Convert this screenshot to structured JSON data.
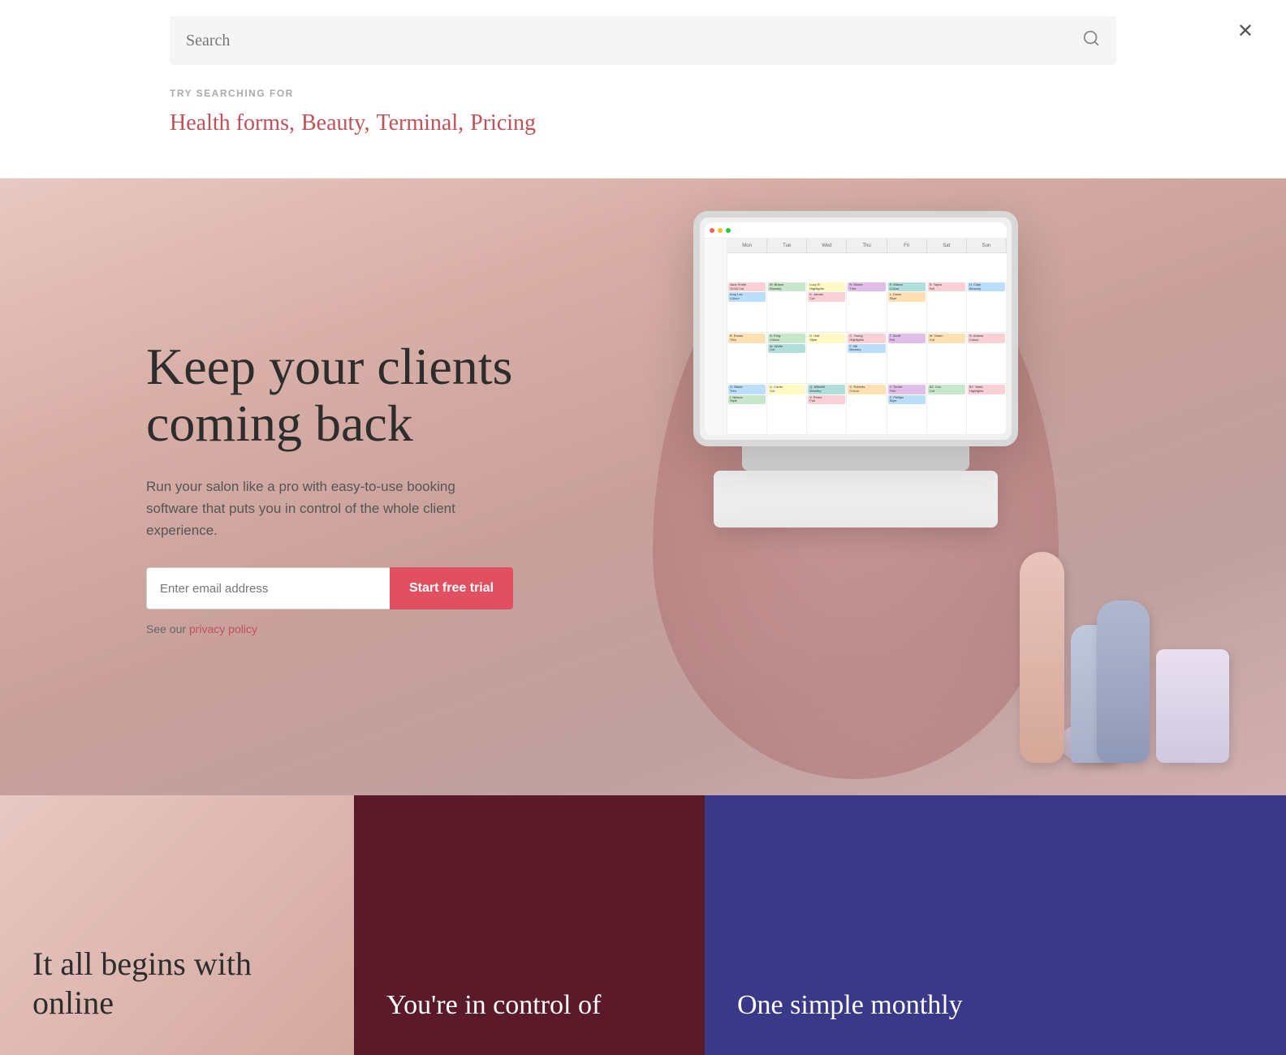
{
  "search": {
    "placeholder": "Search",
    "try_label": "TRY SEARCHING FOR",
    "suggestions": [
      "Health forms,",
      "Beauty,",
      "Terminal,",
      "Pricing"
    ]
  },
  "hero": {
    "title_line1": "Keep your clients",
    "title_line2": "coming back",
    "subtitle": "Run your salon like a pro with easy-to-use booking software that puts you in control of the whole client experience.",
    "email_placeholder": "Enter email address",
    "cta_button": "Start free trial",
    "privacy_prefix": "See our",
    "privacy_link": "privacy policy"
  },
  "bottom": {
    "left_title": "It all begins with online",
    "center_title": "You're in control of",
    "right_title": "One simple monthly"
  },
  "close_label": "✕",
  "search_icon": "🔍"
}
